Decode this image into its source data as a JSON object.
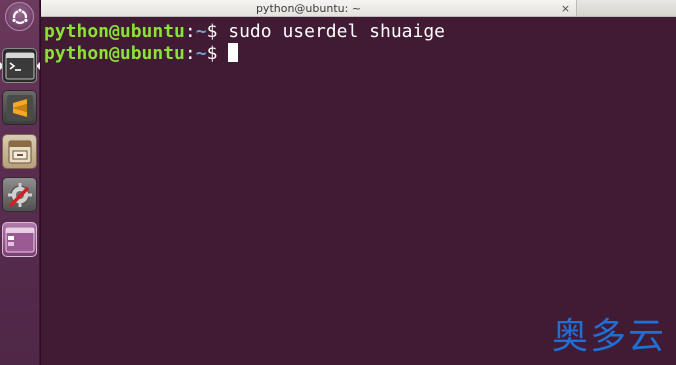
{
  "window": {
    "title": "python@ubuntu: ~",
    "close_glyph": "×"
  },
  "launcher": {
    "items": [
      {
        "name": "dash-button",
        "icon": "ubuntu-logo-icon"
      },
      {
        "name": "terminal",
        "icon": "terminal-icon",
        "running": true,
        "focused": true
      },
      {
        "name": "sublime-text",
        "icon": "sublime-text-icon"
      },
      {
        "name": "file-manager",
        "icon": "file-cabinet-icon"
      },
      {
        "name": "system-settings",
        "icon": "settings-tools-icon"
      },
      {
        "name": "workspace-switcher",
        "icon": "workspace-switcher-icon"
      }
    ]
  },
  "terminal": {
    "lines": [
      {
        "user": "python@ubuntu",
        "sep": ":",
        "path": "~",
        "symbol": "$",
        "command": " sudo userdel shuaige"
      },
      {
        "user": "python@ubuntu",
        "sep": ":",
        "path": "~",
        "symbol": "$",
        "command": " "
      }
    ],
    "colors": {
      "background": "#411a33",
      "user": "#8ae234",
      "path": "#729fcf",
      "text": "#ffffff"
    }
  },
  "watermark": {
    "text": "奥多云"
  }
}
